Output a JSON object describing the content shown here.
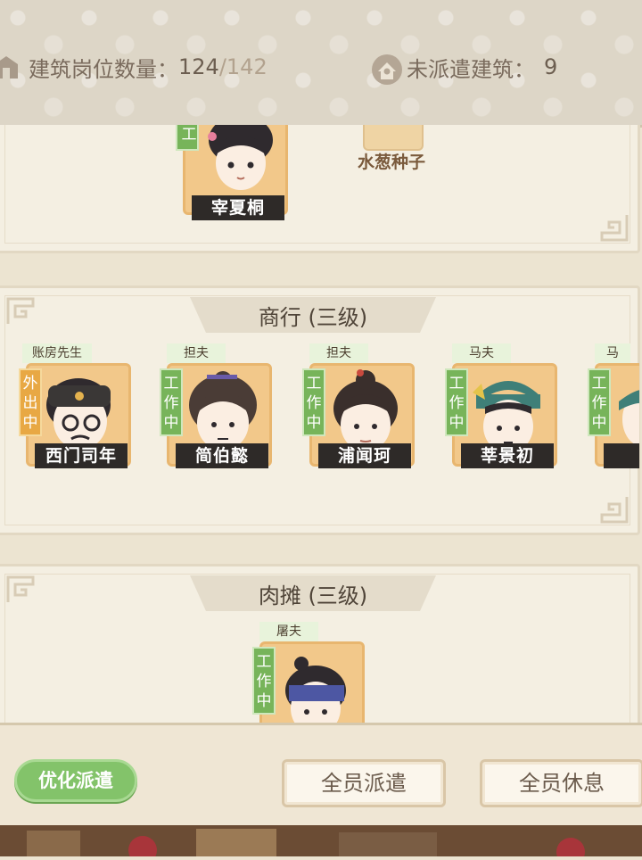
{
  "header": {
    "positions_label": "建筑岗位数量：",
    "positions_current": "124",
    "positions_slash": "/",
    "positions_max": "142",
    "undispatched_label": "未派遣建筑：",
    "undispatched_value": "9"
  },
  "buildings": [
    {
      "title": "",
      "workers": [
        {
          "role": "",
          "status": "工作中",
          "name": "宰夏桐"
        }
      ],
      "item": {
        "name": "水葱种子"
      }
    },
    {
      "title": "商行 (三级)",
      "workers": [
        {
          "role": "账房先生",
          "status": "外出中",
          "name": "西门司年"
        },
        {
          "role": "担夫",
          "status": "工作中",
          "name": "简伯懿"
        },
        {
          "role": "担夫",
          "status": "工作中",
          "name": "浦闻珂"
        },
        {
          "role": "马夫",
          "status": "工作中",
          "name": "莘景初"
        },
        {
          "role": "马",
          "status": "工作中",
          "name": ""
        }
      ]
    },
    {
      "title": "肉摊 (三级)",
      "workers": [
        {
          "role": "屠夫",
          "status": "工作中",
          "name": ""
        }
      ]
    }
  ],
  "footer": {
    "optimize_label": "优化派遣",
    "dispatch_all_label": "全员派遣",
    "rest_all_label": "全员休息"
  },
  "colors": {
    "working_green": "#77b45a",
    "outing_orange": "#e8a844",
    "portrait_bg": "#f2c88a",
    "nameplate": "#2e2a28"
  },
  "icons": [
    "building-icon",
    "house-person-icon",
    "meander-corner-icon"
  ]
}
